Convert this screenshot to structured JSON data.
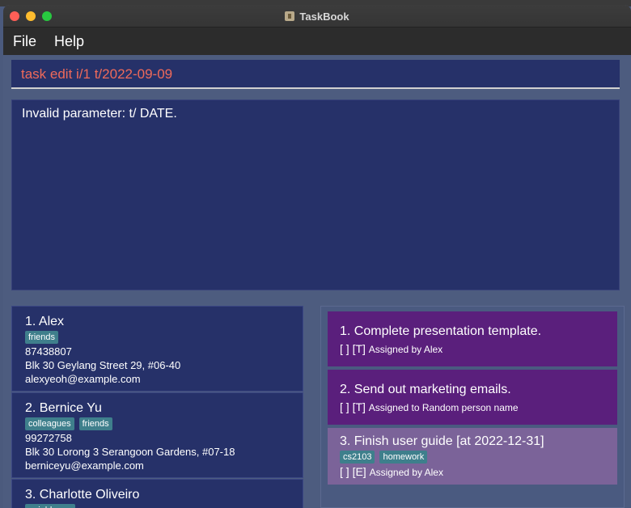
{
  "window": {
    "title": "TaskBook"
  },
  "menu": {
    "file": "File",
    "help": "Help"
  },
  "command": {
    "value": "task edit i/1 t/2022-09-09"
  },
  "result": {
    "text": "Invalid parameter: t/ DATE."
  },
  "persons": [
    {
      "name": "1.  Alex",
      "tags": [
        "friends"
      ],
      "phone": "87438807",
      "address": "Blk 30 Geylang Street 29, #06-40",
      "email": "alexyeoh@example.com"
    },
    {
      "name": "2.  Bernice Yu",
      "tags": [
        "colleagues",
        "friends"
      ],
      "phone": "99272758",
      "address": "Blk 30 Lorong 3 Serangoon Gardens, #07-18",
      "email": "berniceyu@example.com"
    },
    {
      "name": "3.  Charlotte Oliveiro",
      "tags": [
        "neighbours"
      ]
    }
  ],
  "tasks": [
    {
      "title": "1.  Complete presentation template.",
      "checkbox": "[  ]",
      "type": "[T]",
      "assign": "Assigned by  Alex"
    },
    {
      "title": "2.  Send out marketing emails.",
      "checkbox": "[  ]",
      "type": "[T]",
      "assign": "Assigned to  Random person name"
    },
    {
      "title": "3.  Finish user guide [at 2022-12-31]",
      "tags": [
        "cs2103",
        "homework"
      ],
      "checkbox": "[  ]",
      "type": "[E]",
      "assign": "Assigned by  Alex"
    }
  ],
  "colors": {
    "accent_command": "#ef6a5a",
    "panel": "#263169",
    "task": "#5a1f7c",
    "task_selected": "#7b6399",
    "tag": "#3f7f8c"
  }
}
